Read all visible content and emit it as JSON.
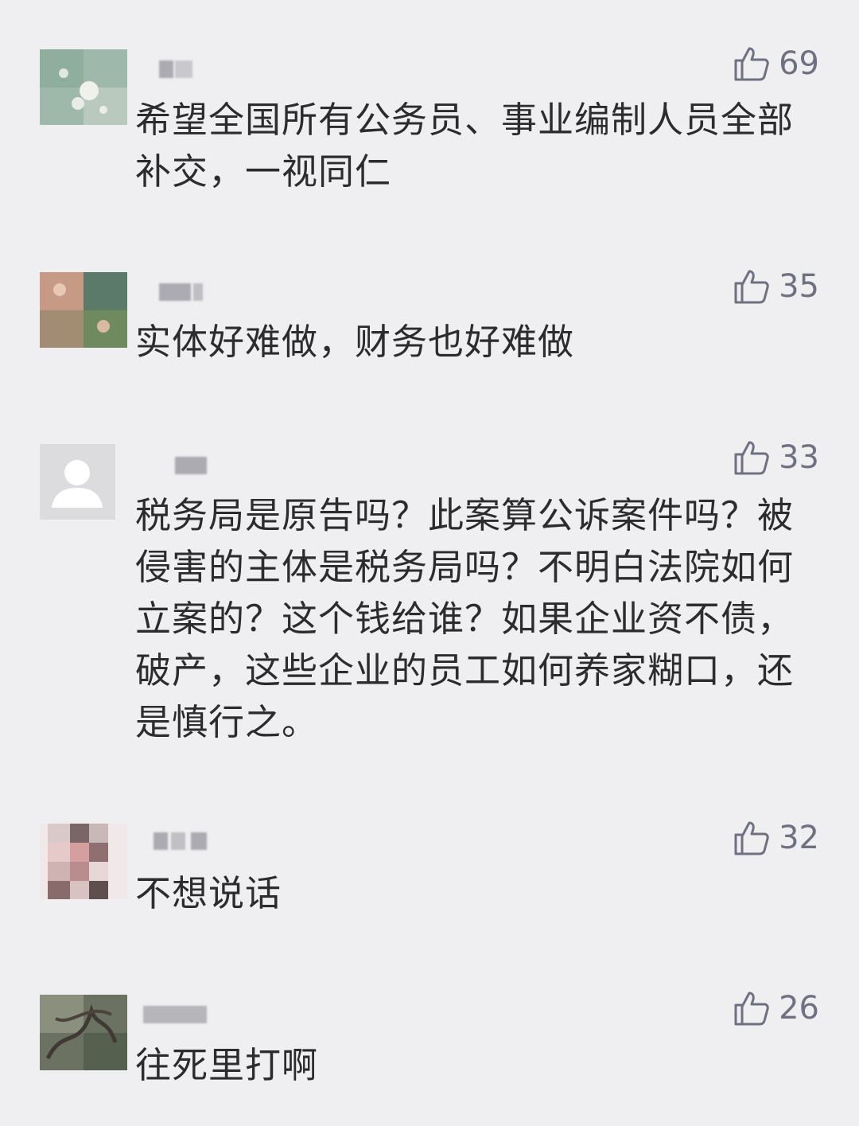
{
  "comments": [
    {
      "avatar": "flower-photo-avatar",
      "likes": "69",
      "text": "希望全国所有公务员、事业编制人员全部补交，一视同仁"
    },
    {
      "avatar": "people-photo-avatar",
      "likes": "35",
      "text": "实体好难做，财务也好难做"
    },
    {
      "avatar": "default-user-avatar",
      "likes": "33",
      "text": "税务局是原告吗？此案算公诉案件吗？被侵害的主体是税务局吗？不明白法院如何立案的？这个钱给谁？如果企业资不债，破产，这些企业的员工如何养家糊口，还是慎行之。"
    },
    {
      "avatar": "pixelated-photo-avatar",
      "likes": "32",
      "text": "不想说话"
    },
    {
      "avatar": "tree-photo-avatar",
      "likes": "26",
      "text": "往死里打啊"
    }
  ],
  "icons": {
    "like": "thumbs-up-icon"
  },
  "colors": {
    "background": "#efeff2",
    "text": "#2c2c2f",
    "like": "#6f7180"
  }
}
